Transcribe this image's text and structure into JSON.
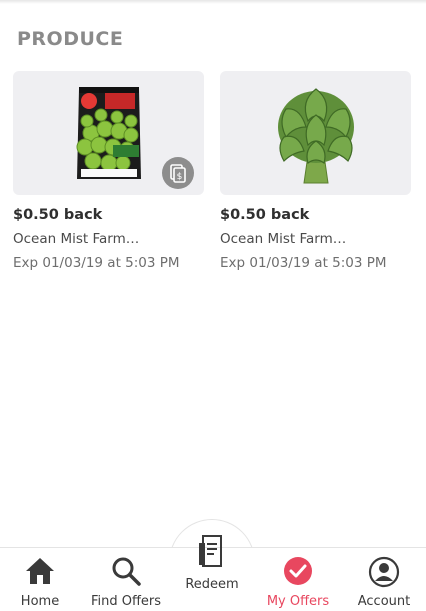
{
  "section": {
    "title": "PRODUCE"
  },
  "offers": [
    {
      "amount": "$0.50 back",
      "name": "Ocean Mist Farm…",
      "expires": "Exp 01/03/19 at 5:03 PM",
      "image": "brussels-sprouts-bag",
      "badge_icon": "stack-offers-icon"
    },
    {
      "amount": "$0.50 back",
      "name": "Ocean Mist Farm…",
      "expires": "Exp 01/03/19 at 5:03 PM",
      "image": "artichoke"
    }
  ],
  "nav": {
    "home": "Home",
    "find_offers": "Find Offers",
    "redeem": "Redeem",
    "my_offers": "My Offers",
    "account": "Account",
    "active_color": "#e8475f"
  }
}
